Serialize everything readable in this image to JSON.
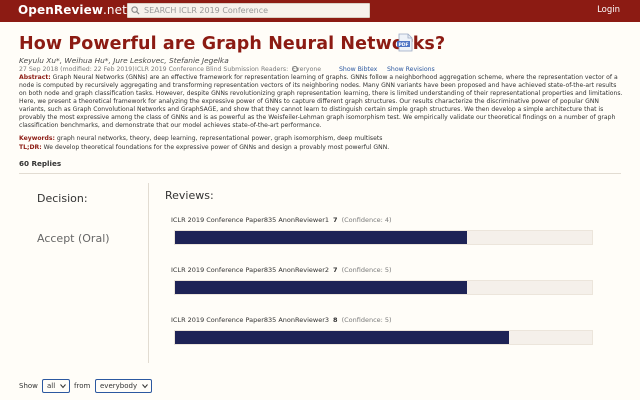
{
  "navbar": {
    "brand_main": "OpenReview",
    "brand_suffix": ".net",
    "search_placeholder": "SEARCH ICLR 2019 Conference",
    "login_label": "Login",
    "color": "#8c1b13"
  },
  "paper": {
    "title": "How Powerful are Graph Neural Networks?",
    "authors": "Keyulu Xu*, Weihua Hu*, Jure Leskovec, Stefanie Jegelka",
    "date": "27 Sep 2018 (modified: 22 Feb 2019)",
    "venue": "ICLR 2019 Conference Blind Submission",
    "readers_label": "Readers:",
    "readers_value": "Everyone",
    "show_bibtex": "Show Bibtex",
    "show_revisions": "Show Revisions",
    "abstract_label": "Abstract:",
    "abstract": "Graph Neural Networks (GNNs) are an effective framework for representation learning of graphs. GNNs follow a neighborhood aggregation scheme, where the representation vector of a node is computed by recursively aggregating and transforming representation vectors of its neighboring nodes. Many GNN variants have been proposed and have achieved state-of-the-art results on both node and graph classification tasks. However, despite GNNs revolutionizing graph representation learning, there is limited understanding of their representational properties and limitations. Here, we present a theoretical framework for analyzing the expressive power of GNNs to capture different graph structures. Our results characterize the discriminative power of popular GNN variants, such as Graph Convolutional Networks and GraphSAGE, and show that they cannot learn to distinguish certain simple graph structures. We then develop a simple architecture that is provably the most expressive among the class of GNNs and is as powerful as the Weisfeiler-Lehman graph isomorphism test. We empirically validate our theoretical findings on a number of graph classification benchmarks, and demonstrate that our model achieves state-of-the-art performance.",
    "keywords_label": "Keywords:",
    "keywords": "graph neural networks, theory, deep learning, representational power, graph isomorphism, deep multisets",
    "tldr_label": "TL;DR:",
    "tldr": "We develop theoretical foundations for the expressive power of GNNs and design a provably most powerful GNN.",
    "replies": "60 Replies",
    "pdf_icon": "pdf-icon"
  },
  "decision": {
    "label": "Decision:",
    "value": "Accept (Oral)"
  },
  "reviews": {
    "title": "Reviews:",
    "bar_color": "#1e2356",
    "max_rating": 10,
    "items": [
      {
        "name": "ICLR 2019 Conference Paper835 AnonReviewer1",
        "rating": "7",
        "confidence": "(Confidence: 4)",
        "rating_value": 7
      },
      {
        "name": "ICLR 2019 Conference Paper835 AnonReviewer2",
        "rating": "7",
        "confidence": "(Confidence: 5)",
        "rating_value": 7
      },
      {
        "name": "ICLR 2019 Conference Paper835 AnonReviewer3",
        "rating": "8",
        "confidence": "(Confidence: 5)",
        "rating_value": 8
      }
    ]
  },
  "filters": {
    "show_label": "Show",
    "show_value": "all",
    "from_label": "from",
    "from_value": "everybody"
  }
}
